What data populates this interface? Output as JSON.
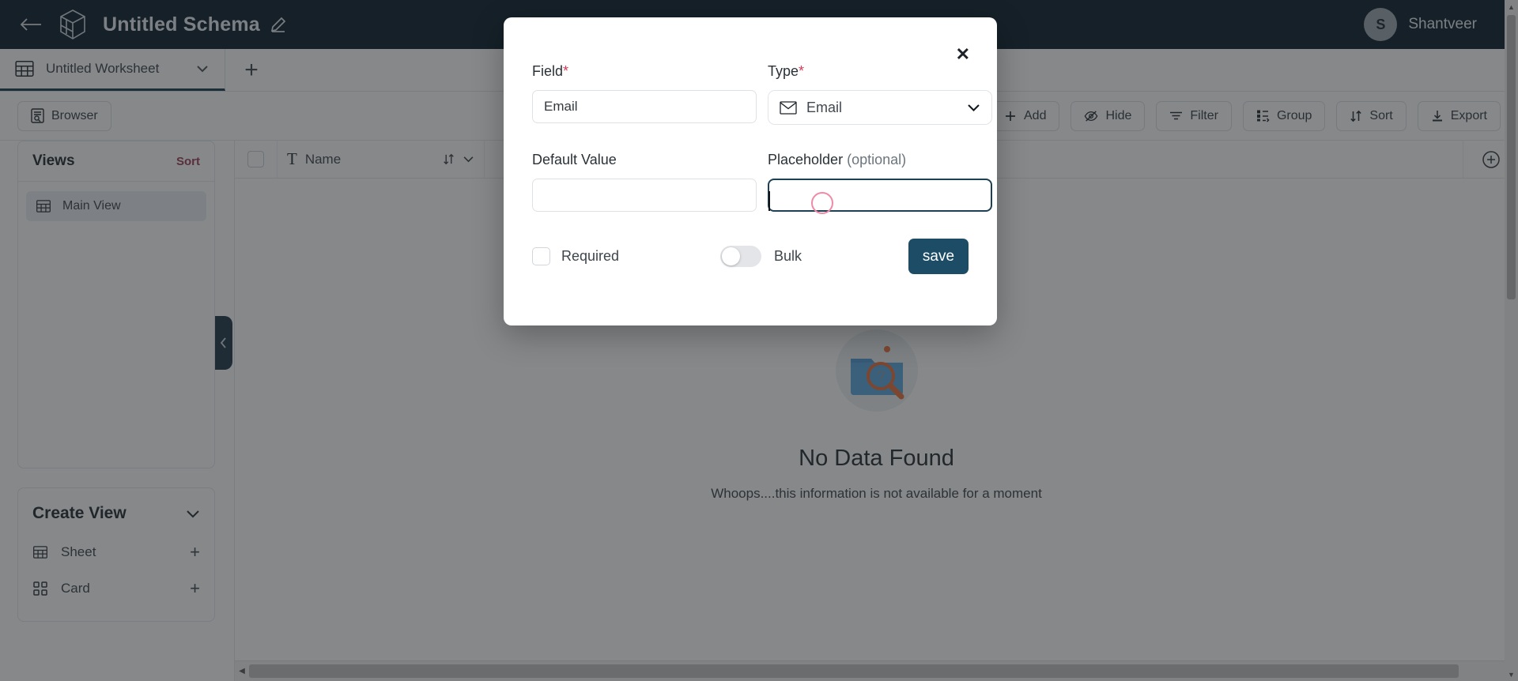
{
  "header": {
    "back_icon": "arrow-left-icon",
    "logo_icon": "cube-logo-icon",
    "schema_title": "Untitled Schema",
    "edit_icon": "pencil-edit-icon",
    "user": {
      "initial": "S",
      "name": "Shantveer"
    }
  },
  "tabbar": {
    "sheet_icon": "grid-table-icon",
    "active_tab": "Untitled Worksheet",
    "tab_chevron_icon": "chevron-down-icon",
    "add_tab_label": "+"
  },
  "toolbar": {
    "browser_label": "Browser",
    "browser_icon": "browser-document-icon",
    "right_buttons": [
      {
        "label": "Add",
        "icon": "plus-icon"
      },
      {
        "label": "Hide",
        "icon": "eye-off-icon"
      },
      {
        "label": "Filter",
        "icon": "filter-icon"
      },
      {
        "label": "Group",
        "icon": "group-icon"
      },
      {
        "label": "Sort",
        "icon": "sort-arrows-icon"
      },
      {
        "label": "Export",
        "icon": "download-icon"
      }
    ]
  },
  "sidebar": {
    "views_title": "Views",
    "views_sort_label": "Sort",
    "views_sort_color": "#9c3a52",
    "views": [
      {
        "label": "Main View",
        "icon": "grid-table-icon"
      }
    ],
    "create_view_title": "Create View",
    "create_view_chevron_icon": "chevron-down-icon",
    "create_options": [
      {
        "label": "Sheet",
        "icon": "grid-table-icon",
        "action": "+"
      },
      {
        "label": "Card",
        "icon": "card-squares-icon",
        "action": "+"
      }
    ],
    "collapse_icon": "chevron-left-icon"
  },
  "grid": {
    "select_all_checkbox": "unchecked",
    "columns": [
      {
        "type_glyph": "T",
        "name": "Name",
        "sort_icon": "sort-arrows-icon",
        "menu_icon": "chevron-down-icon"
      }
    ],
    "add_column_icon": "circle-plus-icon",
    "empty_state": {
      "illustration": "folder-search-not-found-icon",
      "title": "No Data Found",
      "subtitle": "Whoops....this information is not available for a moment"
    },
    "hscroll_left_icon": "triangle-left-icon"
  },
  "modal": {
    "close_icon": "close-x-icon",
    "field_label": "Field",
    "field_required_mark": "*",
    "field_value": "Email",
    "field_placeholder": "Email",
    "type_label": "Type",
    "type_required_mark": "*",
    "type_value": "Email",
    "type_icon": "envelope-icon",
    "type_chevron_icon": "chevron-down-icon",
    "default_value_label": "Default Value",
    "default_value": "",
    "default_value_placeholder": "",
    "placeholder_label": "Placeholder",
    "placeholder_optional_text": "(optional)",
    "placeholder_value": "",
    "placeholder_input_placeholder": "",
    "required_checkbox_label": "Required",
    "required_checked": "unchecked",
    "bulk_toggle_label": "Bulk",
    "bulk_toggle_state": "off",
    "save_label": "save",
    "save_color": "#1d4d66",
    "focus_border_color": "#1d4054",
    "click_indicator_color": "#f08ba6"
  }
}
